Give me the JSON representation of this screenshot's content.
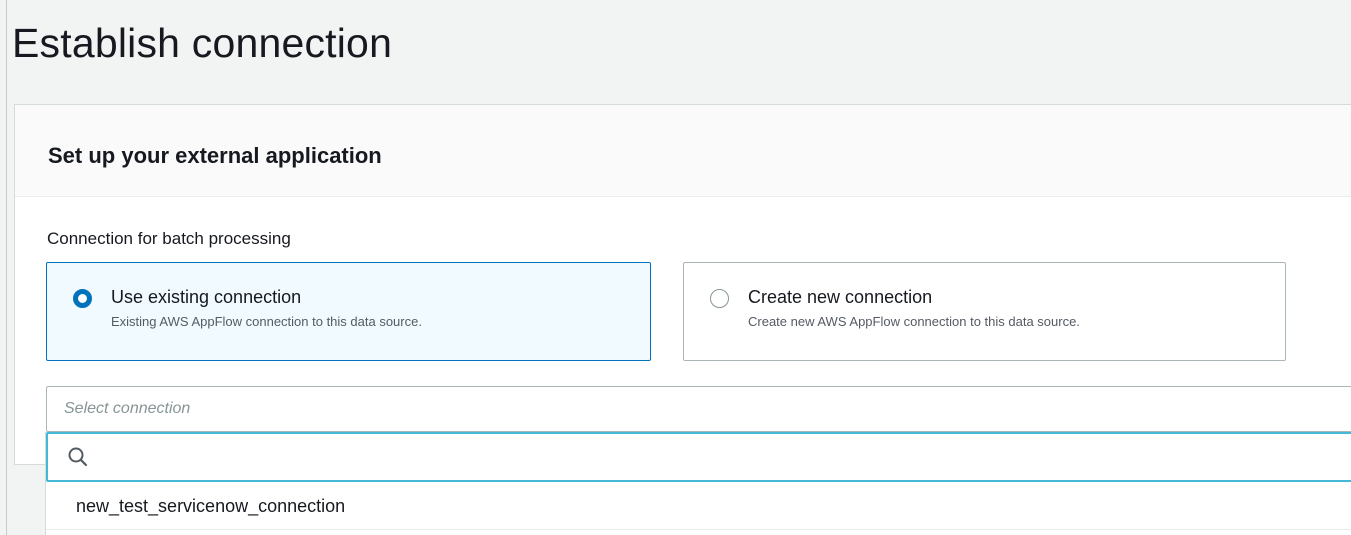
{
  "page": {
    "title": "Establish connection"
  },
  "container": {
    "title": "Set up your external application"
  },
  "batch": {
    "label": "Connection for batch processing",
    "options": [
      {
        "title": "Use existing connection",
        "description": "Existing AWS AppFlow connection to this data source.",
        "selected": true
      },
      {
        "title": "Create new connection",
        "description": "Create new AWS AppFlow connection to this data source.",
        "selected": false
      }
    ]
  },
  "select": {
    "placeholder": "Select connection",
    "search_value": "",
    "options": [
      "new_test_servicenow_connection"
    ]
  },
  "colors": {
    "accent": "#0073bb",
    "focus": "#44b9d6",
    "selected_bg": "#f1faff"
  }
}
